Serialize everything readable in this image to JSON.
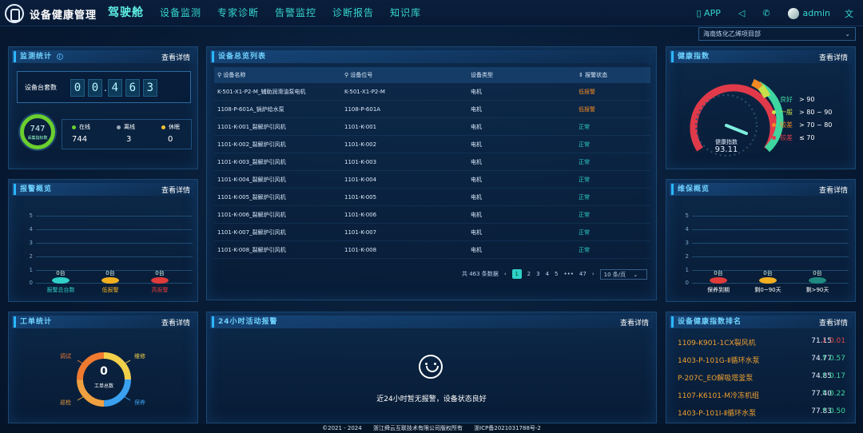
{
  "header": {
    "title": "设备健康管理",
    "nav": [
      "驾驶舱",
      "设备监测",
      "专家诊断",
      "告警监控",
      "诊断报告",
      "知识库"
    ],
    "app_label": "APP",
    "user": "admin"
  },
  "project_select": {
    "value": "海南炼化乙烯项目部"
  },
  "monitor": {
    "title": "监测统计",
    "detail": "查看详情",
    "device_label": "设备台套数",
    "digits": [
      "0",
      "0",
      "4",
      "6",
      "3"
    ],
    "ring_value": "747",
    "ring_label": "采集指标数",
    "online_label": "在线",
    "online": "744",
    "offline_label": "离线",
    "offline": "3",
    "sleep_label": "休眠",
    "sleep": "0",
    "colors": {
      "online": "#6bcf2e",
      "offline": "#9aa9b8",
      "sleep": "#f2c230"
    }
  },
  "alarm": {
    "title": "报警概览",
    "detail": "查看详情",
    "yticks": [
      "5",
      "4",
      "3",
      "2",
      "1",
      "0"
    ],
    "bars": [
      {
        "label": "报警总台数",
        "value": "0台",
        "color": "#2fd0c8"
      },
      {
        "label": "低报警",
        "value": "0台",
        "color": "#f2b020"
      },
      {
        "label": "高报警",
        "value": "0台",
        "color": "#e03a3a"
      }
    ]
  },
  "devices": {
    "title": "设备总览列表",
    "columns": [
      "设备名称",
      "设备位号",
      "设备类型",
      "报警状态"
    ],
    "rows": [
      [
        "K-501-X1-P2-M_辅助润滑油泵电机",
        "K-501-X1-P2-M",
        "电机",
        "低报警"
      ],
      [
        "1108-P-601A_锅炉给水泵",
        "1108-P-601A",
        "电机",
        "低报警"
      ],
      [
        "1101-K-001_裂解炉引风机",
        "1101-K-001",
        "电机",
        "正常"
      ],
      [
        "1101-K-002_裂解炉引风机",
        "1101-K-002",
        "电机",
        "正常"
      ],
      [
        "1101-K-003_裂解炉引风机",
        "1101-K-003",
        "电机",
        "正常"
      ],
      [
        "1101-K-004_裂解炉引风机",
        "1101-K-004",
        "电机",
        "正常"
      ],
      [
        "1101-K-005_裂解炉引风机",
        "1101-K-005",
        "电机",
        "正常"
      ],
      [
        "1101-K-006_裂解炉引风机",
        "1101-K-006",
        "电机",
        "正常"
      ],
      [
        "1101-K-007_裂解炉引风机",
        "1101-K-007",
        "电机",
        "正常"
      ],
      [
        "1101-K-008_裂解炉引风机",
        "1101-K-008",
        "电机",
        "正常"
      ]
    ],
    "pager": {
      "total": "共 463 条数据",
      "pages": [
        "1",
        "2",
        "3",
        "4",
        "5",
        "•••",
        "47"
      ],
      "page_size": "10 条/页"
    }
  },
  "health": {
    "title": "健康指数",
    "detail": "查看详情",
    "value": "93.11",
    "label": "健康指数",
    "value_fraction": 0.9311,
    "legend": [
      {
        "name": "良好",
        "range": "> 90",
        "color": "#3fd6a0"
      },
      {
        "name": "一般",
        "range": "> 80 ~ 90",
        "color": "#c9e04a"
      },
      {
        "name": "较差",
        "range": "> 70 ~ 80",
        "color": "#f08a24"
      },
      {
        "name": "较差",
        "range": "≤ 70",
        "color": "#e03a4a"
      }
    ]
  },
  "maintenance": {
    "title": "维保概览",
    "detail": "查看详情",
    "yticks": [
      "5",
      "4",
      "3",
      "2",
      "1",
      "0"
    ],
    "bars": [
      {
        "label": "保养到期",
        "value": "0台",
        "color": "#e03a3a"
      },
      {
        "label": "剩0~90天",
        "value": "0台",
        "color": "#f2b020"
      },
      {
        "label": "剩>90天",
        "value": "0台",
        "color": "#2fd0a0"
      }
    ]
  },
  "workorder": {
    "title": "工单统计",
    "detail": "查看详情",
    "total": "0",
    "total_label": "工单总数",
    "segments": [
      {
        "label": "调试",
        "color": "#f07a30"
      },
      {
        "label": "维修",
        "color": "#f2d04a"
      },
      {
        "label": "保养",
        "color": "#3aa0f0"
      },
      {
        "label": "巡检",
        "color": "#f0a040"
      }
    ]
  },
  "activity": {
    "title": "24小时活动报警",
    "detail": "查看详情",
    "message": "近24小时暂无报警，设备状态良好"
  },
  "ranking": {
    "title": "设备健康指数排名",
    "detail": "查看详情",
    "rows": [
      {
        "name": "1109-K901-1CX裂风机",
        "score": "71.15",
        "diff": "↓ 0.01",
        "dir": "down"
      },
      {
        "name": "1403-P-101G-Ⅱ循环水泵",
        "score": "74.77",
        "diff": "↑ 0.57",
        "dir": "up"
      },
      {
        "name": "P-207C_EO解吸塔釜泵",
        "score": "74.85",
        "diff": "↑ 0.17",
        "dir": "up"
      },
      {
        "name": "1107-K6101-M冷冻机组",
        "score": "77.40",
        "diff": "↑ 0.22",
        "dir": "up"
      },
      {
        "name": "1403-P-101I-Ⅱ循环水泵",
        "score": "77.83",
        "diff": "↑ 0.50",
        "dir": "up"
      }
    ]
  },
  "footer": {
    "copyright": "©2021 - 2024",
    "company": "浙江舜云互联技术有限公司版权所有",
    "icp": "浙ICP备2021031788号-2"
  }
}
